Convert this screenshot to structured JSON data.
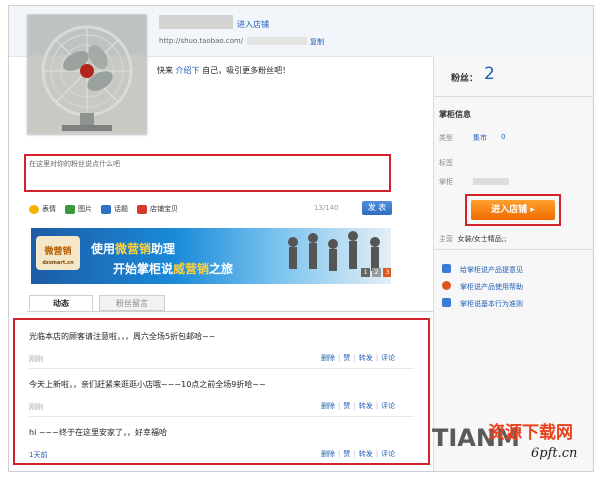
{
  "header": {
    "enter_store_link": "进入店铺",
    "url": "http://shuo.taobao.com/",
    "copy_link": "复制"
  },
  "intro": {
    "before": "快来",
    "link": "介绍下",
    "after": "自己，吸引更多粉丝吧！"
  },
  "stats": {
    "fans_label": "粉丝：",
    "fans_count": "2"
  },
  "shop_info": {
    "title": "掌柜信息",
    "type_label": "类型",
    "type_value": "集市",
    "type_count": "0",
    "tags_label": "标签",
    "shop_label": "掌柜",
    "enter_button": "进入店铺 ▸",
    "main_label": "主营",
    "main_value": "女装/女士精品;;"
  },
  "right_links": [
    {
      "label": "给掌柜说产品提意见",
      "icon_color": "#3a7bd5"
    },
    {
      "label": "掌柜说产品使用帮助",
      "icon_color": "#e0541b"
    },
    {
      "label": "掌柜说基本行为准则",
      "icon_color": "#3a7bd5"
    }
  ],
  "composer": {
    "placeholder": "在这里对你的粉丝说点什么吧",
    "tools": [
      {
        "label": "表情",
        "icon": "emoji-icon",
        "color": "#f5b400"
      },
      {
        "label": "图片",
        "icon": "image-icon",
        "color": "#3c9a3c"
      },
      {
        "label": "话题",
        "icon": "topic-icon",
        "color": "#2f73c9"
      },
      {
        "label": "店铺宝贝",
        "icon": "shop-item-icon",
        "color": "#d33a2c"
      }
    ],
    "counter": "13/140",
    "publish_button": "发 表"
  },
  "banner": {
    "logo_top": "微营销",
    "logo_bottom": "dzsmart.cn",
    "line1_a": "使用",
    "line1_b": "微营销",
    "line1_c": "助理",
    "line2_a": "开始掌柜说",
    "line2_b": "威营销",
    "line2_c": "之旅",
    "pager": [
      "1",
      "2",
      "3"
    ]
  },
  "tabs": {
    "active": "动态",
    "other": "粉丝留言"
  },
  "feed": [
    {
      "text": "光临本店的顾客请注意啦，，，周六全场5折包邮哈~~",
      "time": "刚刚",
      "time_blue": false
    },
    {
      "text": "今天上新啦，，亲们赶紧来逛逛小店哦~~~10点之前全场9折哈~~",
      "time": "刚刚",
      "time_blue": false
    },
    {
      "text": "hi ~~~终于在这里安家了，，好幸福哈",
      "time": "1天前",
      "time_blue": true
    }
  ],
  "feed_actions": {
    "delete": "删除",
    "like": "赞",
    "forward": "转发",
    "comment": "评论"
  },
  "watermark": {
    "brand": "TIANM",
    "site_cn": "资源下载网",
    "site_url": "6pft.cn"
  }
}
